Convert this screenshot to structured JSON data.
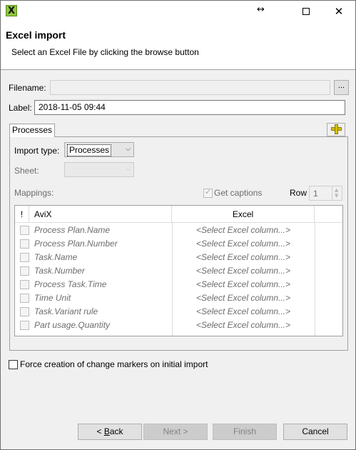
{
  "window": {
    "resize_glyph": "↔",
    "close_glyph": "✕"
  },
  "banner": {
    "title": "Excel import",
    "description": "Select an Excel File by clicking the browse button"
  },
  "form": {
    "filename_label": "Filename:",
    "filename_value": "",
    "browse_label": "...",
    "label_label": "Label:",
    "label_value": "2018-11-05 09:44"
  },
  "processes": {
    "tab_label": "Processes",
    "import_type_label": "Import type:",
    "import_type_value": "Processes",
    "sheet_label": "Sheet:",
    "sheet_value": "",
    "mappings_label": "Mappings:",
    "get_captions_label": "Get captions",
    "get_captions_checked": true,
    "row_label": "Row",
    "row_value": "1"
  },
  "table": {
    "headers": [
      "!",
      "AviX",
      "Excel"
    ],
    "rows": [
      {
        "name": "Process Plan.Name",
        "excel": "<Select Excel column...>"
      },
      {
        "name": "Process Plan.Number",
        "excel": "<Select Excel column...>"
      },
      {
        "name": "Task.Name",
        "excel": "<Select Excel column...>"
      },
      {
        "name": "Task.Number",
        "excel": "<Select Excel column...>"
      },
      {
        "name": "Process Task.Time",
        "excel": "<Select Excel column...>"
      },
      {
        "name": "Time Unit",
        "excel": "<Select Excel column...>"
      },
      {
        "name": "Task.Variant rule",
        "excel": "<Select Excel column...>"
      },
      {
        "name": "Part usage.Quantity",
        "excel": "<Select Excel column...>"
      }
    ]
  },
  "options": {
    "force_markers_label": "Force creation of change markers on initial import"
  },
  "footer": {
    "back_label": "< Back",
    "back_mnemonic": "B",
    "next_label": "Next >",
    "finish_label": "Finish",
    "cancel_label": "Cancel"
  },
  "colors": {
    "accent": "#d8c000",
    "app_icon": "#8ec63f"
  }
}
